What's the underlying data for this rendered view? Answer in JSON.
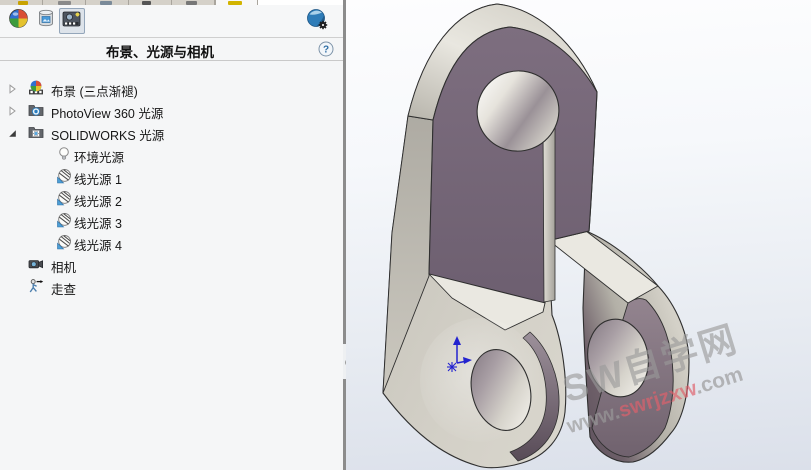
{
  "panel": {
    "title": "布景、光源与相机",
    "help_label": "?",
    "toolbar": [
      {
        "name": "appearances",
        "selected": false
      },
      {
        "name": "decals",
        "selected": false
      },
      {
        "name": "scene-lights-cameras",
        "selected": true
      },
      {
        "name": "render-options",
        "selected": false
      }
    ],
    "tree": [
      {
        "label": "布景 (三点渐褪)",
        "icon": "scene-icon",
        "state": "collapsed",
        "level": 0
      },
      {
        "label": "PhotoView 360 光源",
        "icon": "photoview-lights-folder-icon",
        "state": "collapsed",
        "level": 0
      },
      {
        "label": "SOLIDWORKS 光源",
        "icon": "solidworks-lights-folder-icon",
        "state": "expanded",
        "level": 0
      },
      {
        "label": "环境光源",
        "icon": "ambient-light-icon",
        "level": 1
      },
      {
        "label": "线光源 1",
        "icon": "directional-light-icon",
        "level": 1
      },
      {
        "label": "线光源 2",
        "icon": "directional-light-icon",
        "level": 1
      },
      {
        "label": "线光源 3",
        "icon": "directional-light-icon",
        "level": 1
      },
      {
        "label": "线光源 4",
        "icon": "directional-light-icon",
        "level": 1
      },
      {
        "label": "相机",
        "icon": "camera-icon",
        "level": 0
      },
      {
        "label": "走查",
        "icon": "walkthrough-icon",
        "level": 0
      }
    ]
  },
  "viewport": {
    "watermark": {
      "line1": "SW自学网",
      "line2_prefix": "www.",
      "line2_highlight": "swrjzxw",
      "line2_suffix": ".com"
    },
    "colors": {
      "model_gray": "#d2cfc6",
      "model_mauve": "#776879",
      "watermark_gray": "#9a9a9a",
      "watermark_red": "#e0616c",
      "origin_blue": "#2323cf"
    }
  }
}
